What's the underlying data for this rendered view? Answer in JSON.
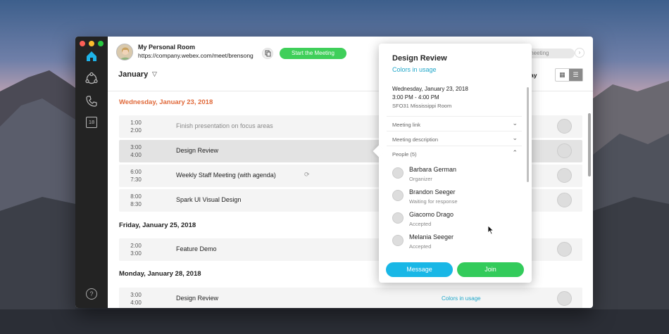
{
  "room": {
    "title": "My Personal Room",
    "url": "https://company.webex.com/meet/brensong",
    "start_label": "Start the Meeting"
  },
  "header": {
    "month": "January",
    "search_placeholder": "meeting",
    "view_label": "ay"
  },
  "sidebar": {
    "calendar_badge": "18"
  },
  "days": [
    {
      "label": "Wednesday, January 23, 2018",
      "events": [
        {
          "start": "1:00",
          "end": "2:00",
          "title": "Finish presentation on focus areas",
          "tag": ""
        },
        {
          "start": "3:00",
          "end": "4:00",
          "title": "Design Review",
          "tag": ""
        },
        {
          "start": "6:00",
          "end": "7:30",
          "title": "Weekly Staff Meeting (with agenda)",
          "tag": ""
        },
        {
          "start": "8:00",
          "end": "8:30",
          "title": "Spark UI Visual Design",
          "tag": ""
        }
      ]
    },
    {
      "label": "Friday, January 25, 2018",
      "events": [
        {
          "start": "2:00",
          "end": "3:00",
          "title": "Feature Demo",
          "tag": ""
        }
      ]
    },
    {
      "label": "Monday, January 28, 2018",
      "events": [
        {
          "start": "3:00",
          "end": "4:00",
          "title": "Design Review",
          "tag": "Colors in usage"
        }
      ]
    }
  ],
  "popover": {
    "title": "Design Review",
    "subtitle": "Colors in usage",
    "date": "Wednesday, January 23, 2018",
    "time": "3:00 PM - 4:00 PM",
    "room": "SFO31 Mississippi Room",
    "sections": [
      "Meeting link",
      "Meeting description",
      "People (5)"
    ],
    "people": [
      {
        "name": "Barbara German",
        "status": "Organizer"
      },
      {
        "name": "Brandon Seeger",
        "status": "Waiting for response"
      },
      {
        "name": "Giacomo Drago",
        "status": "Accepted"
      },
      {
        "name": "Melania Seeger",
        "status": "Accepted"
      }
    ],
    "message_label": "Message",
    "join_label": "Join"
  },
  "colors": {
    "accent_green": "#3fcf5a",
    "accent_blue": "#19b7e6",
    "today_orange": "#e0693a",
    "link_teal": "#1ea6c9"
  }
}
